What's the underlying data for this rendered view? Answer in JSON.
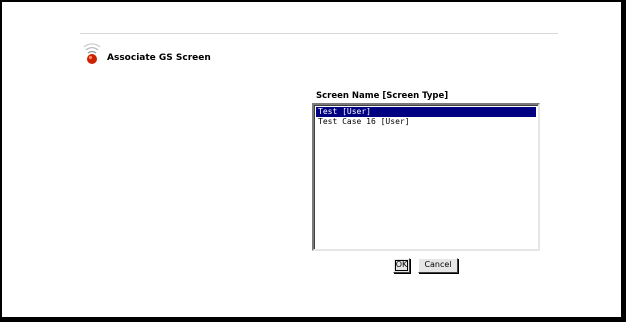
{
  "dialog": {
    "title": "Associate GS Screen",
    "list_header": "Screen Name [Screen Type]",
    "options": [
      "Test [User]",
      "Test Case 16  [User]"
    ],
    "selected_index": 0,
    "ok_label": "OK",
    "cancel_label": "Cancel"
  },
  "colors": {
    "selection": "#000080",
    "logo_red": "#cc2200",
    "signal_grey": "#9a9a9a"
  }
}
